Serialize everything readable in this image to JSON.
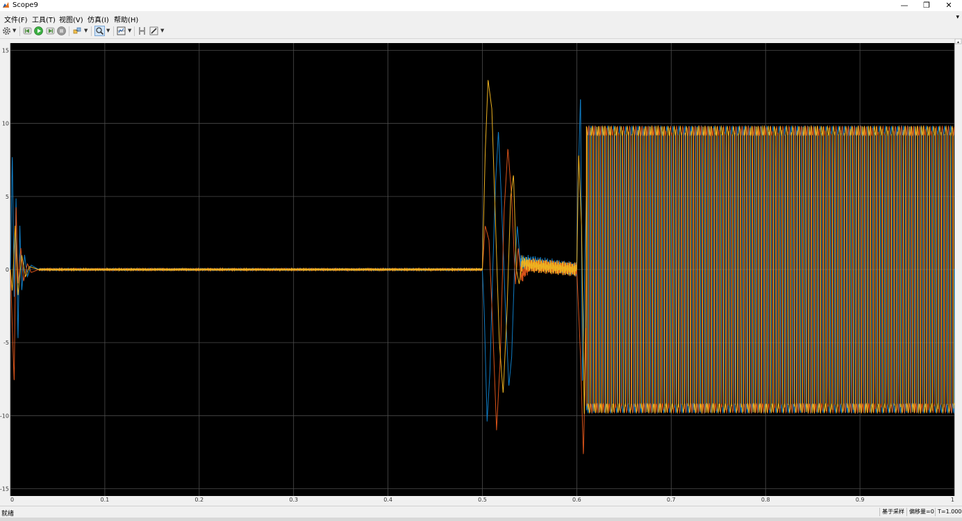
{
  "window": {
    "title": "Scope9",
    "minimize": "—",
    "restore": "❐",
    "close": "✕"
  },
  "menu": [
    "文件(F)",
    "工具(T)",
    "视图(V)",
    "仿真(I)",
    "帮助(H)"
  ],
  "menu_overflow": "▾",
  "toolbar": {
    "icons": [
      "gear-icon",
      "step-back-icon",
      "run-icon",
      "step-forward-icon",
      "stop-icon",
      "highlight-icon",
      "zoom-icon",
      "autoscale-icon",
      "cursor-measure-icon",
      "edit-icon"
    ],
    "run_color": "#3cb043",
    "stop_color": "#9a9a9a"
  },
  "status": {
    "left": "就绪",
    "mode": "基于采样",
    "offset": "偏移量=0",
    "time": "T=1.000"
  },
  "chart_data": {
    "type": "line",
    "title": "",
    "xlabel": "",
    "ylabel": "",
    "xlim": [
      0,
      1
    ],
    "ylim": [
      -15.5,
      15.5
    ],
    "xticks": [
      "0",
      "0.1",
      "0.2",
      "0.3",
      "0.4",
      "0.5",
      "0.6",
      "0.7",
      "0.8",
      "0.9",
      "1"
    ],
    "yticks": [
      "15",
      "10",
      "5",
      "0",
      "-5",
      "-10",
      "-15"
    ],
    "grid": true,
    "background": "#000000",
    "grid_color": "#4d4d4d",
    "series": [
      {
        "color": "#0f7cc4",
        "phase": 0,
        "points": [
          [
            0,
            0
          ],
          [
            0.002,
            8.0
          ],
          [
            0.004,
            -2
          ],
          [
            0.006,
            5
          ],
          [
            0.008,
            -5
          ],
          [
            0.01,
            3
          ],
          [
            0.012,
            -1.5
          ],
          [
            0.015,
            1.0
          ],
          [
            0.018,
            -0.5
          ],
          [
            0.022,
            0.3
          ],
          [
            0.03,
            0
          ],
          [
            0.5,
            0
          ],
          [
            0.502,
            -3
          ],
          [
            0.505,
            -10.4
          ],
          [
            0.508,
            -7
          ],
          [
            0.511,
            0
          ],
          [
            0.514,
            6
          ],
          [
            0.517,
            9.5
          ],
          [
            0.52,
            5
          ],
          [
            0.524,
            -2
          ],
          [
            0.528,
            -8
          ],
          [
            0.531,
            -6
          ],
          [
            0.534,
            0
          ],
          [
            0.537,
            3
          ],
          [
            0.54,
            0.5
          ],
          [
            0.55,
            0.5
          ],
          [
            0.6,
            0
          ],
          [
            0.601,
            5
          ],
          [
            0.604,
            12.0
          ],
          [
            0.606,
            -8
          ],
          [
            0.61,
            5
          ],
          [
            1,
            0
          ]
        ]
      },
      {
        "color": "#d95319",
        "phase": 2.094,
        "points": [
          [
            0,
            0
          ],
          [
            0.002,
            -4
          ],
          [
            0.004,
            -7.8
          ],
          [
            0.006,
            4.5
          ],
          [
            0.008,
            -1
          ],
          [
            0.011,
            1.5
          ],
          [
            0.014,
            -0.8
          ],
          [
            0.018,
            0.4
          ],
          [
            0.022,
            -0.2
          ],
          [
            0.03,
            0
          ],
          [
            0.5,
            0
          ],
          [
            0.503,
            3
          ],
          [
            0.507,
            2
          ],
          [
            0.511,
            -4
          ],
          [
            0.515,
            -11.0
          ],
          [
            0.519,
            -6
          ],
          [
            0.523,
            4
          ],
          [
            0.527,
            8.3
          ],
          [
            0.531,
            5
          ],
          [
            0.535,
            -1
          ],
          [
            0.538,
            1.5
          ],
          [
            0.541,
            -0.5
          ],
          [
            0.55,
            0.3
          ],
          [
            0.6,
            0
          ],
          [
            0.604,
            -6
          ],
          [
            0.607,
            -12.8
          ],
          [
            0.61,
            -4
          ],
          [
            1,
            0
          ]
        ]
      },
      {
        "color": "#edb120",
        "phase": 4.189,
        "points": [
          [
            0,
            0
          ],
          [
            0.002,
            -1.5
          ],
          [
            0.005,
            3
          ],
          [
            0.008,
            -1.8
          ],
          [
            0.012,
            1
          ],
          [
            0.016,
            -0.5
          ],
          [
            0.02,
            0.2
          ],
          [
            0.03,
            0
          ],
          [
            0.5,
            0
          ],
          [
            0.503,
            8
          ],
          [
            0.506,
            13.0
          ],
          [
            0.51,
            11
          ],
          [
            0.514,
            3
          ],
          [
            0.518,
            -5
          ],
          [
            0.522,
            -8.5
          ],
          [
            0.526,
            -3
          ],
          [
            0.53,
            5
          ],
          [
            0.533,
            6.5
          ],
          [
            0.536,
            0
          ],
          [
            0.539,
            -1
          ],
          [
            0.542,
            0.5
          ],
          [
            0.55,
            0.3
          ],
          [
            0.6,
            0
          ],
          [
            0.602,
            8
          ],
          [
            0.605,
            3
          ],
          [
            0.608,
            -10.3
          ],
          [
            0.611,
            6
          ],
          [
            1,
            0
          ]
        ]
      }
    ]
  }
}
